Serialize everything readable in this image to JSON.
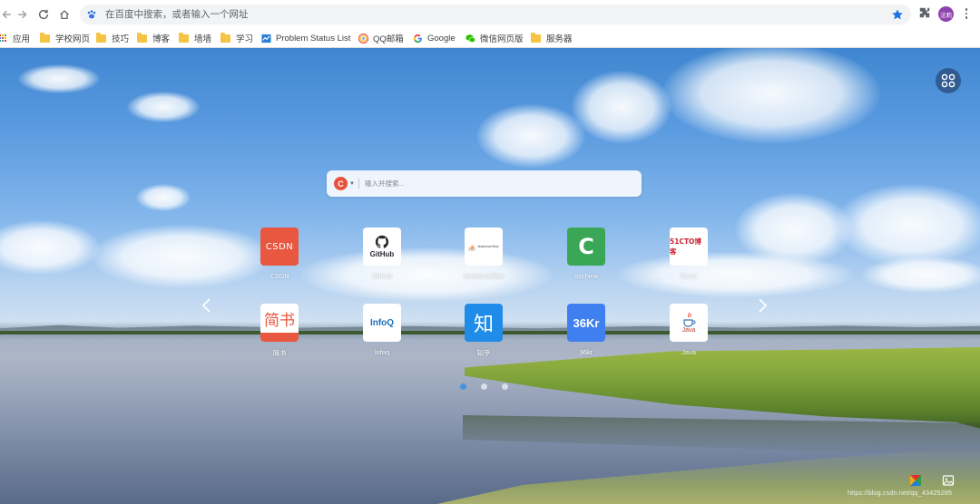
{
  "omnibox": {
    "placeholder": "在百度中搜索，或者输入一个网址"
  },
  "profile": {
    "label": "法莉"
  },
  "bookmarks": [
    {
      "label": "应用",
      "icon": "apps-grid-icon"
    },
    {
      "label": "学校网页",
      "icon": "folder-icon"
    },
    {
      "label": "技巧",
      "icon": "folder-icon"
    },
    {
      "label": "博客",
      "icon": "folder-icon"
    },
    {
      "label": "墙墙",
      "icon": "folder-icon"
    },
    {
      "label": "学习",
      "icon": "folder-icon"
    },
    {
      "label": "Problem Status List",
      "icon": "problem-status-icon"
    },
    {
      "label": "QQ邮箱",
      "icon": "qq-mail-icon"
    },
    {
      "label": "Google",
      "icon": "google-icon"
    },
    {
      "label": "微信网页版",
      "icon": "wechat-icon"
    },
    {
      "label": "服务器",
      "icon": "folder-icon"
    }
  ],
  "search": {
    "placeholder": "输入并搜索...",
    "engine_letter": "C"
  },
  "quicklinks": [
    {
      "label": "CSDN",
      "logo": "CSDN"
    },
    {
      "label": "Github",
      "logo": "GitHub"
    },
    {
      "label": "stackoverflow",
      "logo": "stackoverflow"
    },
    {
      "label": "oschina",
      "logo": "C"
    },
    {
      "label": "51cto",
      "logo": "51CTO博客"
    },
    {
      "label": "简书",
      "logo": "简书"
    },
    {
      "label": "infoq",
      "logo": "InfoQ"
    },
    {
      "label": "知乎",
      "logo": "知"
    },
    {
      "label": "36kr",
      "logo": "36Kr"
    },
    {
      "label": "Java",
      "logo": "Java"
    }
  ],
  "pagination": {
    "pages": 3,
    "current": 1
  },
  "watermark": "https://blog.csdn.net/qq_43425285",
  "colors": {
    "accent": "#1a73e8",
    "csdn": "#e8573f",
    "oschina": "#3aa757",
    "zhihu": "#1e8ce8",
    "kr36": "#3f7ff0"
  }
}
